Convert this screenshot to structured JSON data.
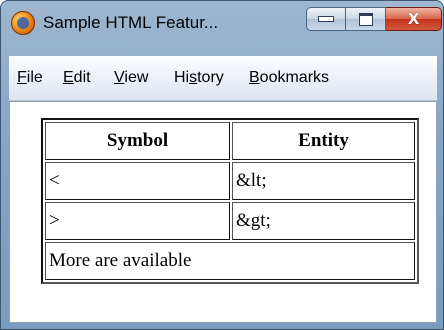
{
  "window": {
    "title": "Sample HTML Featur...",
    "buttons": {
      "minimize": "–",
      "maximize": "□",
      "close": "X"
    }
  },
  "menu": {
    "items": [
      {
        "first": "F",
        "rest": "ile"
      },
      {
        "first": "E",
        "rest": "dit"
      },
      {
        "first": "V",
        "rest": "iew"
      },
      {
        "pre": "Hi",
        "first": "s",
        "rest": "tory"
      },
      {
        "first": "B",
        "rest": "ookmarks"
      }
    ]
  },
  "table": {
    "headers": [
      "Symbol",
      "Entity"
    ],
    "rows": [
      [
        "<",
        "&lt;"
      ],
      [
        ">",
        "&gt;"
      ]
    ],
    "footer": "More are available"
  },
  "colors": {
    "frame": "#86a6c4",
    "close_button": "#c3321a"
  },
  "icons": {
    "app": "firefox-icon",
    "minimize": "minimize-icon",
    "maximize": "maximize-icon",
    "close": "close-icon"
  }
}
